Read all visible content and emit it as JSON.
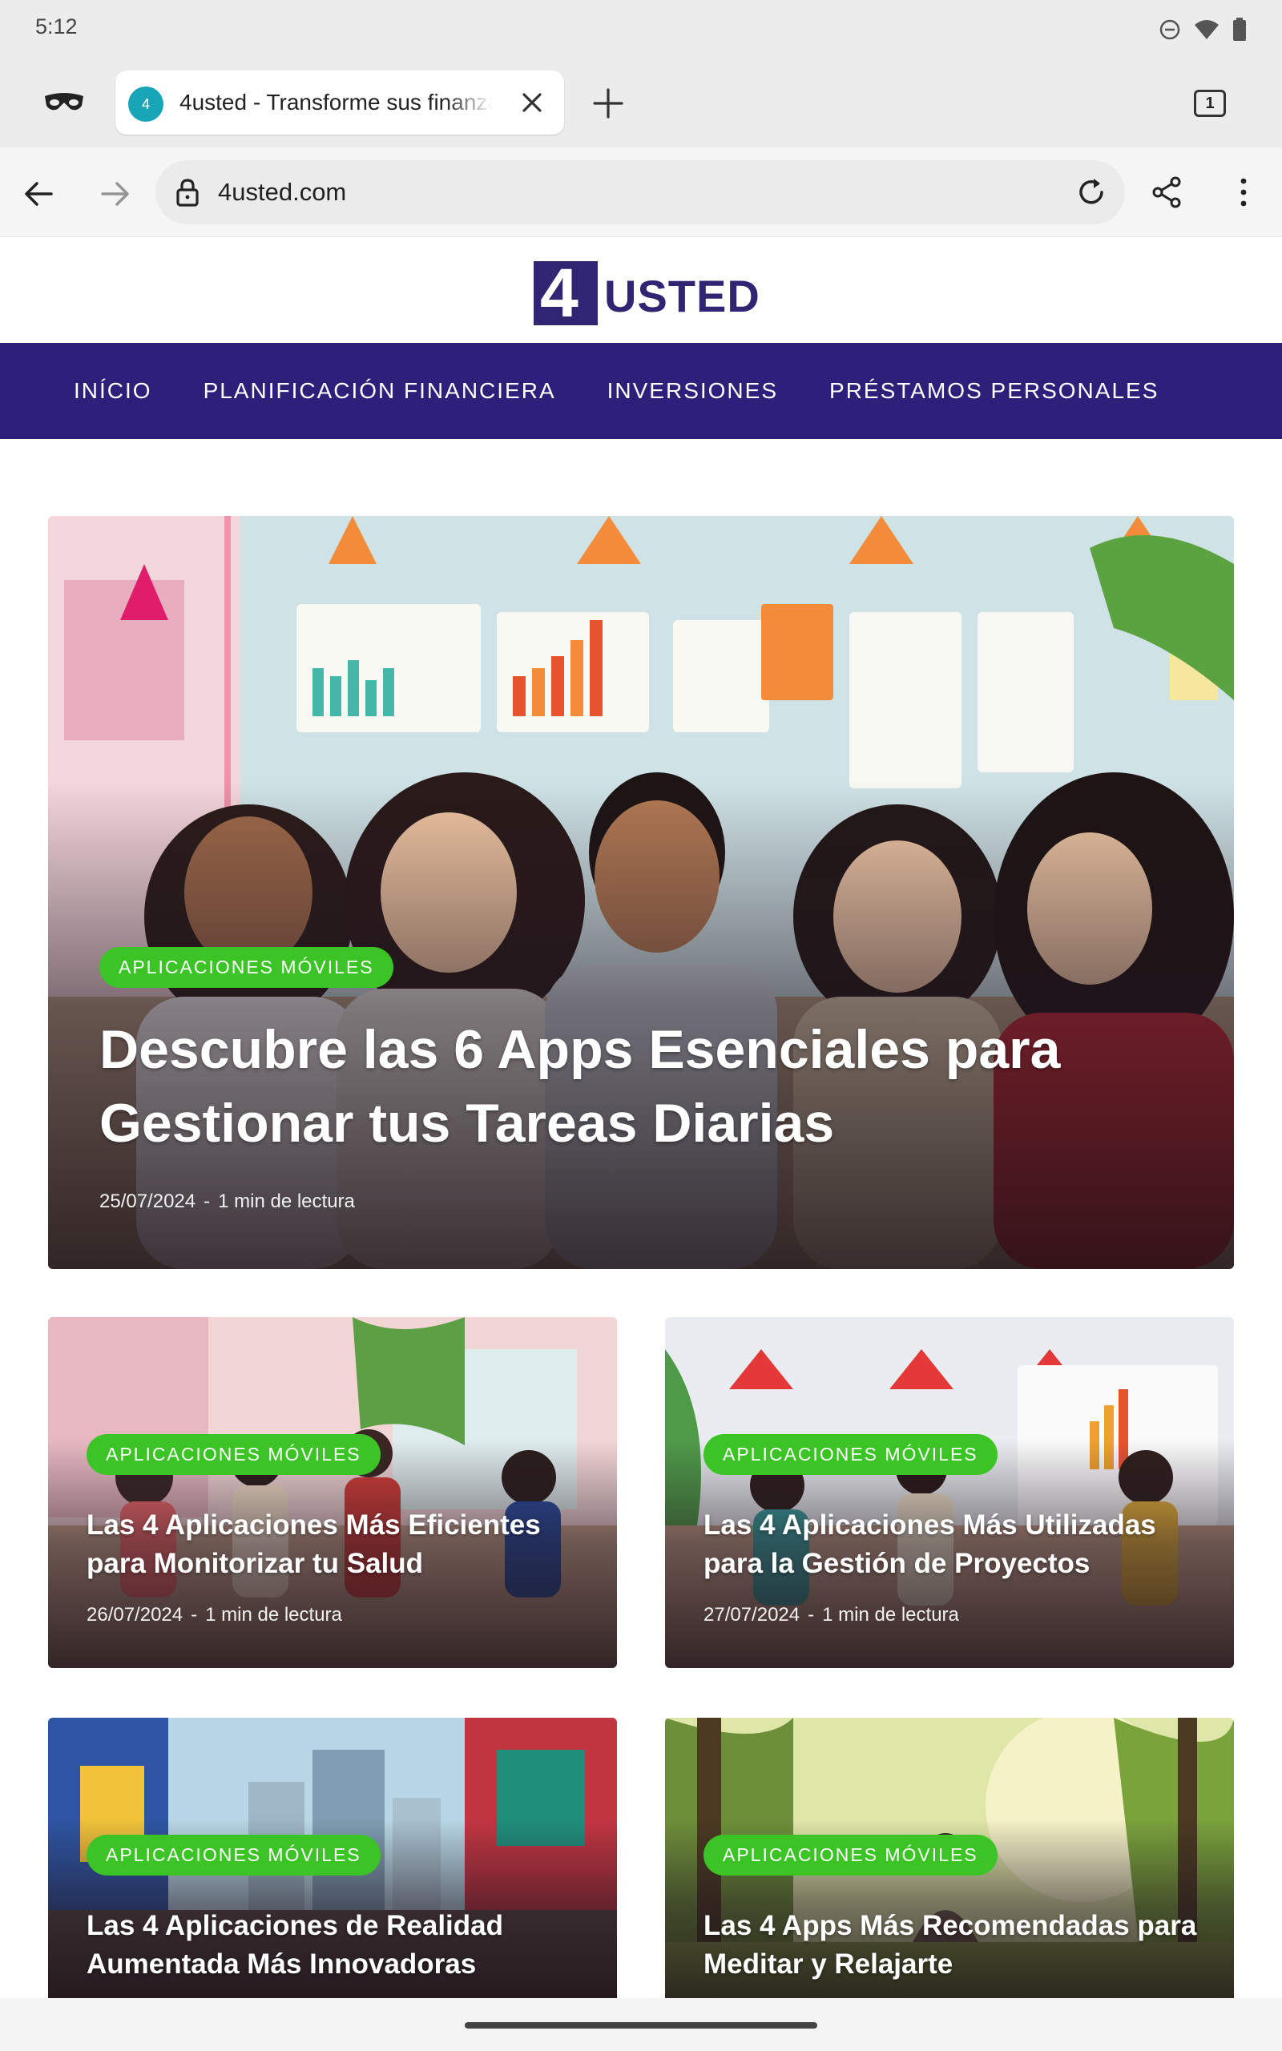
{
  "status_bar": {
    "time": "5:12",
    "icons": [
      "do-not-disturb-icon",
      "wifi-icon",
      "battery-icon"
    ]
  },
  "tab_strip": {
    "incognito_icon": "incognito-icon",
    "active_tab": {
      "favicon_text": "4",
      "title": "4usted - Transforme sus finanzas"
    },
    "tab_count": "1"
  },
  "toolbar": {
    "url": "4usted.com"
  },
  "site": {
    "logo_digit": "4",
    "logo_text": "USTED",
    "brand_color": "#2e1f7a",
    "accent_color": "#3cc427",
    "nav": [
      {
        "label": "INÍCIO"
      },
      {
        "label": "PLANIFICACIÓN FINANCIERA"
      },
      {
        "label": "INVERSIONES"
      },
      {
        "label": "PRÉSTAMOS PERSONALES"
      }
    ]
  },
  "articles": {
    "hero": {
      "category": "APLICACIONES MÓVILES",
      "title": "Descubre las 6 Apps Esenciales para Gestionar tus Tareas Diarias",
      "date": "25/07/2024",
      "separator": "-",
      "read_time": "1 min de lectura"
    },
    "cards": [
      {
        "category": "APLICACIONES MÓVILES",
        "title": "Las 4 Aplicaciones Más Eficientes para Monitorizar tu Salud",
        "date": "26/07/2024",
        "separator": "-",
        "read_time": "1 min de lectura"
      },
      {
        "category": "APLICACIONES MÓVILES",
        "title": "Las 4 Aplicaciones Más Utilizadas para la Gestión de Proyectos",
        "date": "27/07/2024",
        "separator": "-",
        "read_time": "1 min de lectura"
      },
      {
        "category": "APLICACIONES MÓVILES",
        "title": "Las 4 Aplicaciones de Realidad Aumentada Más Innovadoras"
      },
      {
        "category": "APLICACIONES MÓVILES",
        "title": "Las 4 Apps Más Recomendadas para Meditar y Relajarte"
      }
    ]
  }
}
